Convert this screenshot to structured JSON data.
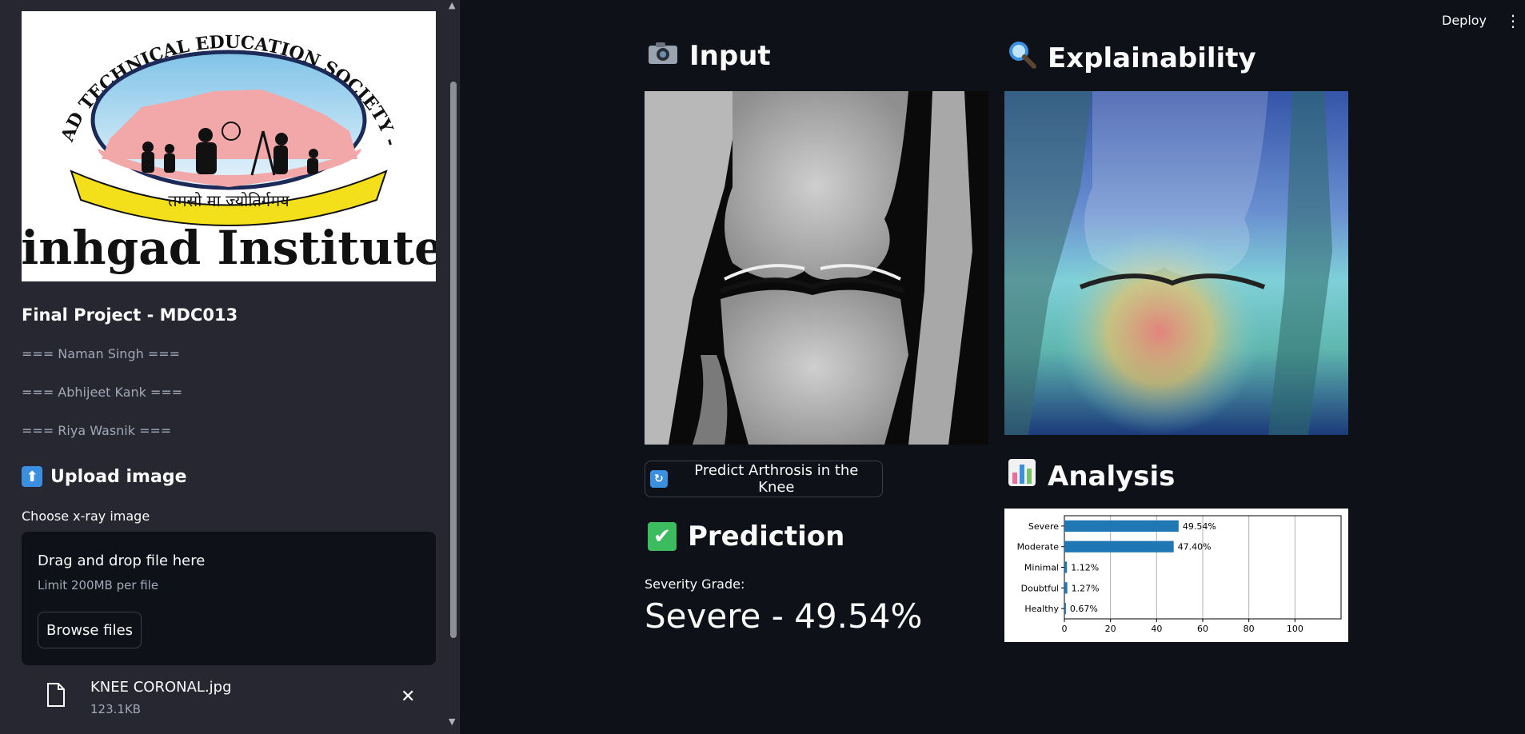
{
  "header": {
    "deploy_label": "Deploy",
    "menu_icon": "kebab-menu-icon"
  },
  "sidebar": {
    "logo": {
      "arc_text": "SINHGAD TECHNICAL EDUCATION SOCIETY - PUNE",
      "banner_text": "तमसो मा ज्योतिर्गमय",
      "name_text": "Sinhgad Institutes"
    },
    "project_title": "Final Project - MDC013",
    "members": [
      "=== Naman Singh ===",
      "=== Abhijeet Kank ===",
      "=== Riya Wasnik ==="
    ],
    "upload_heading": "Upload image",
    "upload_icon": "up-arrow-icon",
    "uploader": {
      "label": "Choose x-ray image",
      "drop_text": "Drag and drop file here",
      "limit_text": "Limit 200MB per file",
      "browse_label": "Browse files"
    },
    "file": {
      "name": "KNEE CORONAL.jpg",
      "size": "123.1KB"
    }
  },
  "main": {
    "input_heading": "Input",
    "input_icon": "camera-icon",
    "explain_heading": "Explainability",
    "explain_icon": "magnifier-icon",
    "predict_button": "Predict Arthrosis in the Knee",
    "predict_icon": "refresh-icon",
    "prediction_heading": "Prediction",
    "prediction_icon": "check-mark-icon",
    "severity_label": "Severity Grade:",
    "severity_value": "Severe - 49.54%",
    "analysis_heading": "Analysis",
    "analysis_icon": "bar-chart-icon"
  },
  "colors": {
    "background": "#0e1117",
    "sidebar": "#262730",
    "bar": "#1f77b4",
    "check": "#3dbb5f"
  },
  "chart_data": {
    "type": "bar",
    "orientation": "horizontal",
    "categories": [
      "Severe",
      "Moderate",
      "Minimal",
      "Doubtful",
      "Healthy"
    ],
    "values": [
      49.54,
      47.4,
      1.12,
      1.27,
      0.67
    ],
    "value_labels": [
      "49.54%",
      "47.40%",
      "1.12%",
      "1.27%",
      "0.67%"
    ],
    "xlim": [
      0,
      120
    ],
    "xticks": [
      0,
      20,
      40,
      60,
      80,
      100
    ],
    "grid": "vertical",
    "title": "",
    "xlabel": "",
    "ylabel": ""
  }
}
